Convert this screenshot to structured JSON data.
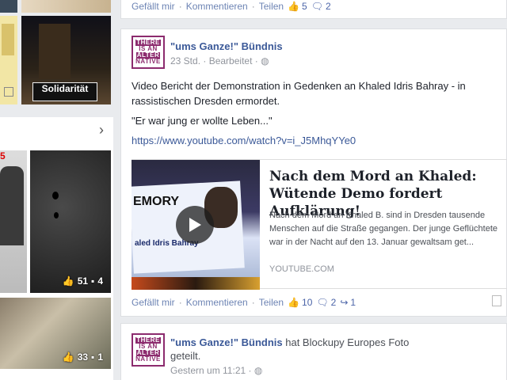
{
  "top_post": {
    "like_label": "Gefällt mir",
    "comment_label": "Kommentieren",
    "share_label": "Teilen",
    "likes": "5",
    "comments": "2"
  },
  "left": {
    "solidarity_text": "Solidarität",
    "photo1_likes": "51",
    "photo1_comments": "4",
    "photo2_likes": "33",
    "photo2_comments": "1"
  },
  "post1": {
    "author": "\"ums Ganze!\" Bündnis",
    "time": "23 Std.",
    "edited": "Bearbeitet",
    "text_line1": "Video Bericht der Demonstration in Gedenken an Khaled Idris Bahray - in",
    "text_line2": "rassistischen Dresden ermordet.",
    "quote": "\"Er war jung er wollte Leben...\"",
    "url": "https://www.youtube.com/watch?v=i_J5MhqYYe0",
    "preview": {
      "title": "Nach dem Mord an Khaled: Wütende Demo fordert Aufklärung!",
      "description": "Nach dem Mord an Khaled B. sind in Dresden tausende Menschen auf die Straße gegangen. Der junge Geflüchtete war in der Nacht auf den 13. Januar gewaltsam get...",
      "source": "YOUTUBE.COM",
      "banner_word": "EMORY",
      "banner_name": "aled Idris Bahray"
    },
    "like_label": "Gefällt mir",
    "comment_label": "Kommentieren",
    "share_label": "Teilen",
    "likes": "10",
    "comments": "2",
    "shares": "1"
  },
  "post2": {
    "author": "\"ums Ganze!\" Bündnis",
    "action": "hat Blockupy Europes Foto",
    "action2": "geteilt.",
    "time": "Gestern um 11:21"
  },
  "logo": {
    "r1": "THERE",
    "r2": "IS AN",
    "r3": "ALTER",
    "r4": "NATIVE"
  },
  "colors": {
    "link": "#3b5998",
    "logo": "#8c2b6e",
    "bg": "#e9ebee"
  }
}
